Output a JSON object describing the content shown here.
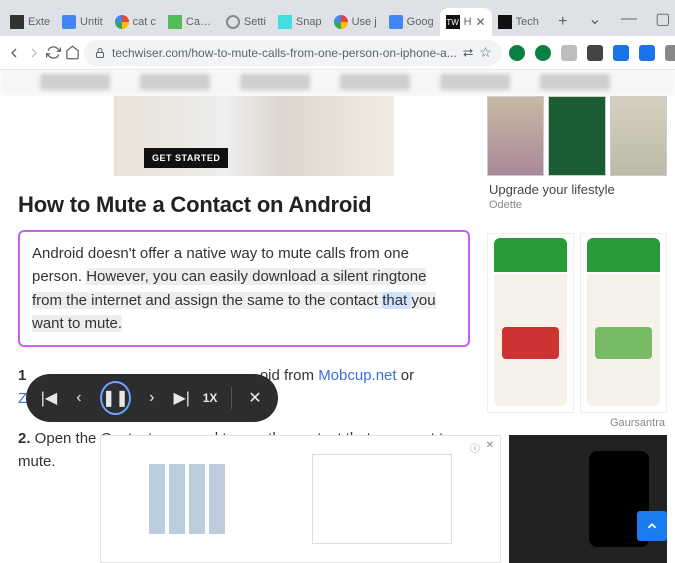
{
  "window": {
    "tabs": [
      {
        "label": "Exte"
      },
      {
        "label": "Untit"
      },
      {
        "label": "cat c"
      },
      {
        "label": "Cat C"
      },
      {
        "label": "Setti"
      },
      {
        "label": "Snap"
      },
      {
        "label": "Use j"
      },
      {
        "label": "Goog"
      },
      {
        "label": "H",
        "active": true
      },
      {
        "label": "Tech"
      }
    ],
    "newtab_glyph": "+",
    "dropdown_glyph": "⌄",
    "minimize_glyph": "—",
    "restore_glyph": "▢",
    "close_glyph": "✕"
  },
  "toolbar": {
    "url": "techwiser.com/how-to-mute-calls-from-one-person-on-iphone-a...",
    "share_glyph": "⮂",
    "star_glyph": "☆"
  },
  "article": {
    "ad_button": "GET STARTED",
    "heading": "How to Mute a Contact on Android",
    "para_plain_lead": "Android doesn't offer a native way to mute calls from one person. ",
    "para_gray_before": "However, you can easily download a silent ringtone from the internet and assign the same to the contact ",
    "para_selected_word": "that ",
    "para_gray_after": "you want to mute.",
    "step1_num": "1",
    "step1_tail": "oid from ",
    "step1_link1": "Mobcup.net",
    "step1_or": " or ",
    "step1_link2": "Z",
    "step2_num": "2.",
    "step2_text": " Open the Contacts app and tap on the contact that you want to mute."
  },
  "player": {
    "prev_track": "|◀",
    "rewind": "‹",
    "pause": "❚❚",
    "forward": "›",
    "next_track": "▶|",
    "speed": "1X",
    "close": "✕"
  },
  "sidebar": {
    "ad1_caption": "Upgrade your lifestyle",
    "ad1_brand": "Odette",
    "brand2": "Gaursantra"
  },
  "bottom_ad": {
    "close": "✕",
    "info": "ⓘ"
  },
  "scrolltop_glyph": "⌃"
}
